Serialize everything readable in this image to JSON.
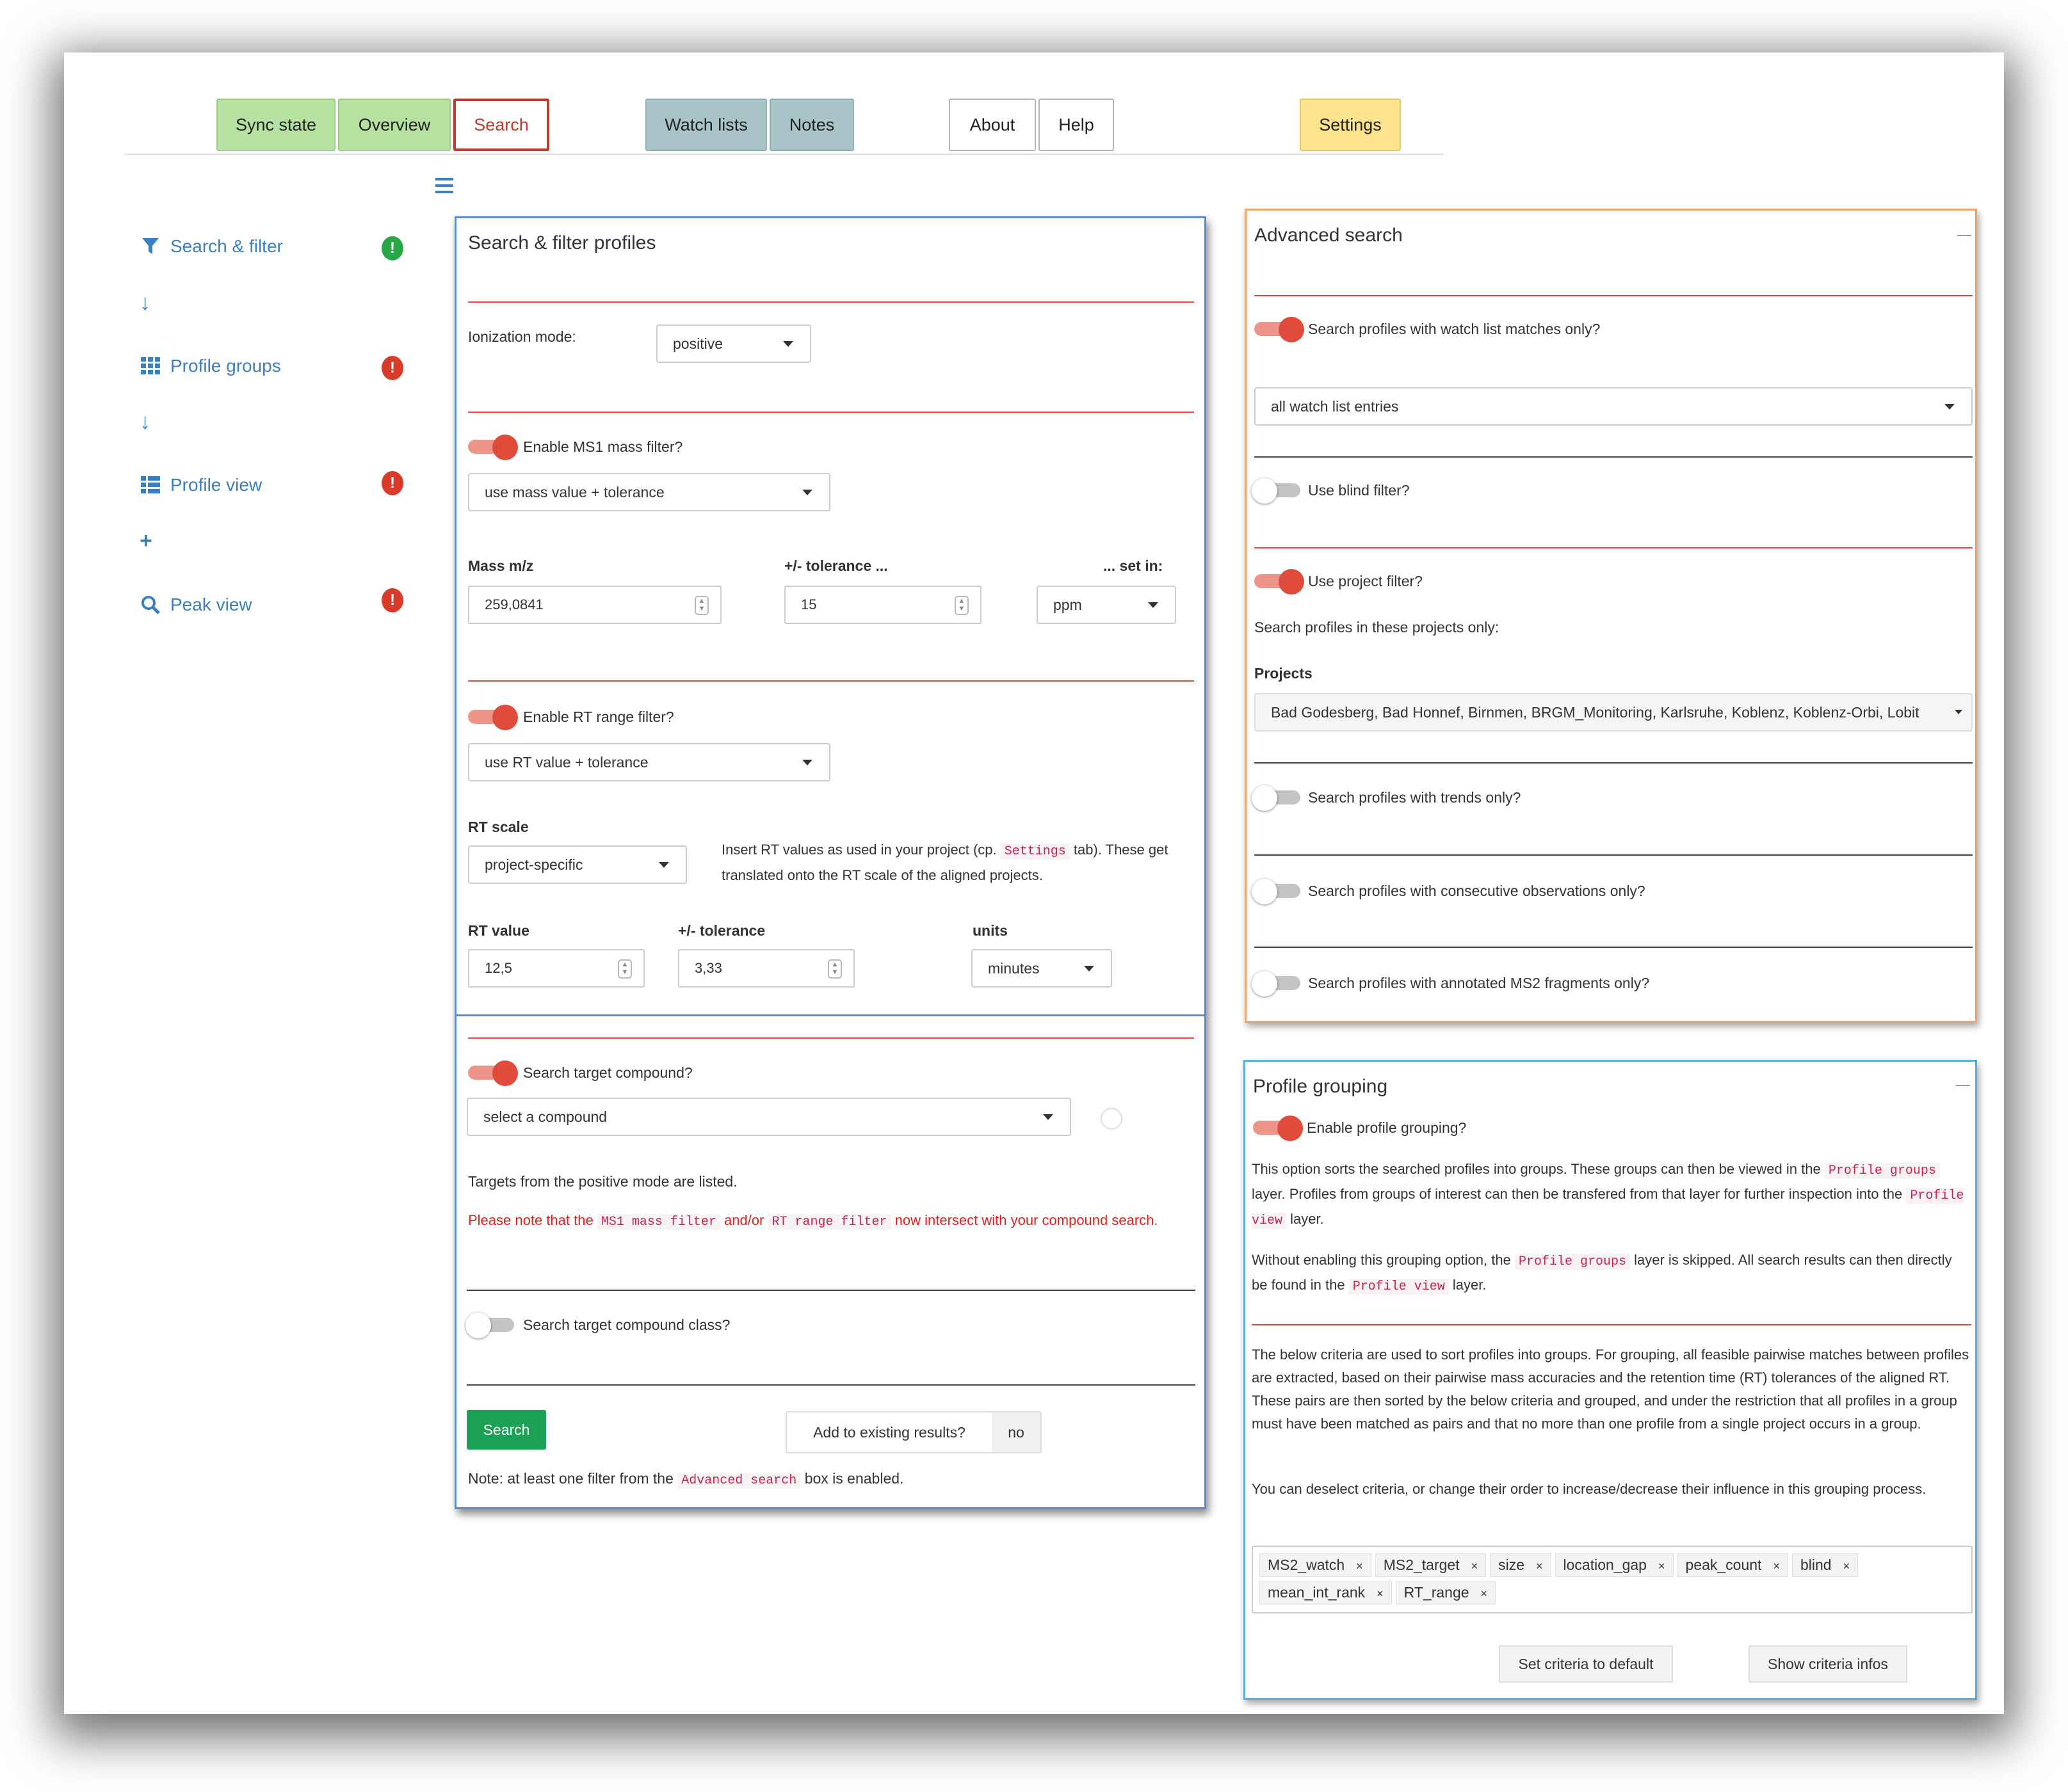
{
  "nav": {
    "tabs": [
      "Sync state",
      "Overview",
      "Search",
      "Watch lists",
      "Notes",
      "About",
      "Help",
      "Settings"
    ]
  },
  "sidebar": {
    "items": [
      {
        "label": "Search & filter",
        "status": "!"
      },
      {
        "label": "Profile groups",
        "status": "!"
      },
      {
        "label": "Profile view",
        "status": "!"
      },
      {
        "label": "Peak view",
        "status": "!"
      }
    ],
    "connectors": [
      "↓",
      "↓",
      "+"
    ]
  },
  "search_panel": {
    "title": "Search & filter profiles",
    "ionization_label": "Ionization mode:",
    "ionization_value": "positive",
    "ms1_toggle_label": "Enable MS1 mass filter?",
    "ms1_toggle_on": true,
    "ms1_method": "use mass value + tolerance",
    "mass_label": "Mass m/z",
    "mass_value": "259,0841",
    "tol_label": "+/- tolerance ...",
    "tol_value": "15",
    "setin_label": "... set in:",
    "setin_value": "ppm",
    "rt_toggle_label": "Enable RT range filter?",
    "rt_toggle_on": true,
    "rt_method": "use RT value + tolerance",
    "rt_scale_label": "RT scale",
    "rt_scale_value": "project-specific",
    "rt_note_pre": "Insert RT values as used in your project (cp.",
    "rt_note_code": "Settings",
    "rt_note_post": "tab). These get translated onto the RT scale of the aligned projects.",
    "rt_value_label": "RT value",
    "rt_value": "12,5",
    "rt_tol_label": "+/- tolerance",
    "rt_tol_value": "3,33",
    "units_label": "units",
    "units_value": "minutes",
    "target_toggle_label": "Search target compound?",
    "target_toggle_on": true,
    "compound_placeholder": "select a compound",
    "targets_note": "Targets from the positive mode are listed.",
    "warn_pre": "Please note that the",
    "warn_code1": "MS1 mass filter",
    "warn_mid": "and/or",
    "warn_code2": "RT range filter",
    "warn_post": "now intersect with your compound search.",
    "class_toggle_label": "Search target compound class?",
    "class_toggle_on": false,
    "search_button": "Search",
    "add_label": "Add to existing results?",
    "add_value": "no",
    "note_pre": "Note: at least one filter from the",
    "note_code": "Advanced search",
    "note_post": "box is enabled."
  },
  "advanced": {
    "title": "Advanced search",
    "watch_toggle_label": "Search profiles with watch list matches only?",
    "watch_toggle_on": true,
    "watch_select": "all watch list entries",
    "blind_label": "Use blind filter?",
    "blind_on": false,
    "project_label": "Use project filter?",
    "project_on": true,
    "project_note": "Search profiles in these projects only:",
    "projects_label": "Projects",
    "projects_value": "Bad Godesberg, Bad Honnef, Birnmen, BRGM_Monitoring, Karlsruhe, Koblenz, Koblenz-Orbi, Lobit",
    "trends_label": "Search profiles with trends only?",
    "trends_on": false,
    "consec_label": "Search profiles with consecutive observations only?",
    "consec_on": false,
    "ms2_label": "Search profiles with annotated MS2 fragments only?",
    "ms2_on": false
  },
  "grouping": {
    "title": "Profile grouping",
    "toggle_label": "Enable profile grouping?",
    "toggle_on": true,
    "p1_a": "This option sorts the searched profiles into groups. These groups can then be viewed in the",
    "p1_code1": "Profile groups",
    "p1_b": "layer. Profiles from groups of interest can then be transfered from that layer for further inspection into the",
    "p1_code2": "Profile view",
    "p1_c": "layer.",
    "p2_a": "Without enabling this grouping option, the",
    "p2_code1": "Profile groups",
    "p2_b": "layer is skipped. All search results can then directly be found in the",
    "p2_code2": "Profile view",
    "p2_c": "layer.",
    "p3": "The below criteria are used to sort profiles into groups. For grouping, all feasible pairwise matches between profiles are extracted, based on their pairwise mass accuracies and the retention time (RT) tolerances of the aligned RT. These pairs are then sorted by the below criteria and grouped, and under the restriction that all profiles in a group must have been matched as pairs and that no more than one profile from a single project occurs in a group.",
    "p4": "You can deselect criteria, or change their order to increase/decrease their influence in this grouping process.",
    "criteria": [
      "MS2_watch",
      "MS2_target",
      "size",
      "location_gap",
      "peak_count",
      "blind",
      "mean_int_rank",
      "RT_range"
    ],
    "remove_glyph": "×",
    "default_button": "Set criteria to default",
    "infos_button": "Show criteria infos"
  },
  "icons": {
    "menu": "hamburger-icon",
    "filter": "funnel-icon",
    "groups": "grid-icon",
    "view": "list-icon",
    "peak": "magnifier-icon"
  },
  "colors": {
    "accent_blue": "#3a7fc1",
    "toggle_red": "#e04b3c",
    "search_green": "#1aa155",
    "advanced_border": "#f2a36a",
    "grouping_border": "#5aaee0",
    "search_border": "#5b8bd4"
  }
}
